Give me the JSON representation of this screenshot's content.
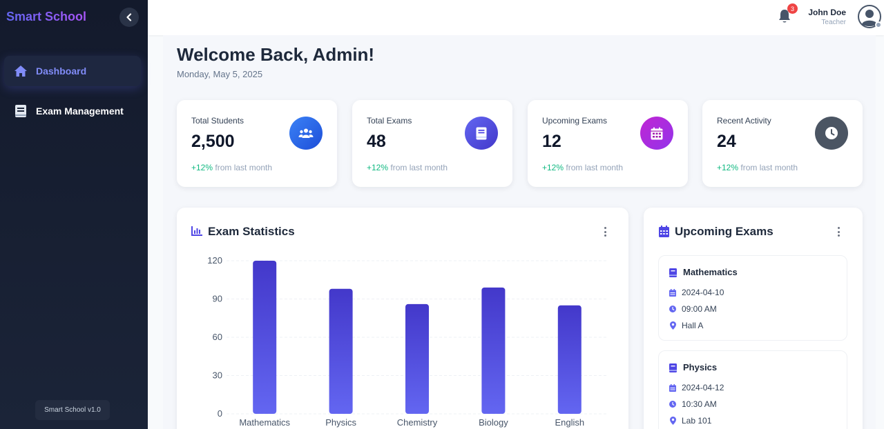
{
  "sidebar": {
    "brand": "Smart School",
    "nav": [
      {
        "label": "Dashboard",
        "icon": "home-icon",
        "active": true
      },
      {
        "label": "Exam Management",
        "icon": "book-icon",
        "active": false
      }
    ],
    "version": "Smart School v1.0"
  },
  "topbar": {
    "notifications_count": "3",
    "user_name": "John Doe",
    "user_role": "Teacher"
  },
  "header": {
    "welcome": "Welcome Back, Admin!",
    "date": "Monday, May 5, 2025"
  },
  "stats": [
    {
      "label": "Total Students",
      "value": "2,500",
      "change": "+12%",
      "change_suffix": " from last month",
      "icon": "users-icon",
      "color": "#2563eb"
    },
    {
      "label": "Total Exams",
      "value": "48",
      "change": "+12%",
      "change_suffix": " from last month",
      "icon": "book-icon",
      "color": "#4f46e5"
    },
    {
      "label": "Upcoming Exams",
      "value": "12",
      "change": "+12%",
      "change_suffix": " from last month",
      "icon": "calendar-icon",
      "color": "#a21caf"
    },
    {
      "label": "Recent Activity",
      "value": "24",
      "change": "+12%",
      "change_suffix": " from last month",
      "icon": "clock-icon",
      "color": "#4b5563"
    }
  ],
  "exam_stats": {
    "title": "Exam Statistics"
  },
  "chart_data": {
    "type": "bar",
    "title": "Exam Statistics",
    "categories": [
      "Mathematics",
      "Physics",
      "Chemistry",
      "Biology",
      "English"
    ],
    "values": [
      120,
      98,
      86,
      99,
      85
    ],
    "ylim": [
      0,
      120
    ],
    "yticks": [
      0,
      30,
      60,
      90,
      120
    ],
    "grid": true,
    "colors": {
      "top": "#4338ca",
      "bottom": "#6366f1"
    }
  },
  "upcoming": {
    "title": "Upcoming Exams",
    "exams": [
      {
        "name": "Mathematics",
        "date": "2024-04-10",
        "time": "09:00 AM",
        "location": "Hall A"
      },
      {
        "name": "Physics",
        "date": "2024-04-12",
        "time": "10:30 AM",
        "location": "Lab 101"
      }
    ]
  },
  "colors": {
    "accent": "#6366f1",
    "positive": "#10b981",
    "badge": "#ef4444",
    "sidebar_bg": "#131a2c"
  }
}
